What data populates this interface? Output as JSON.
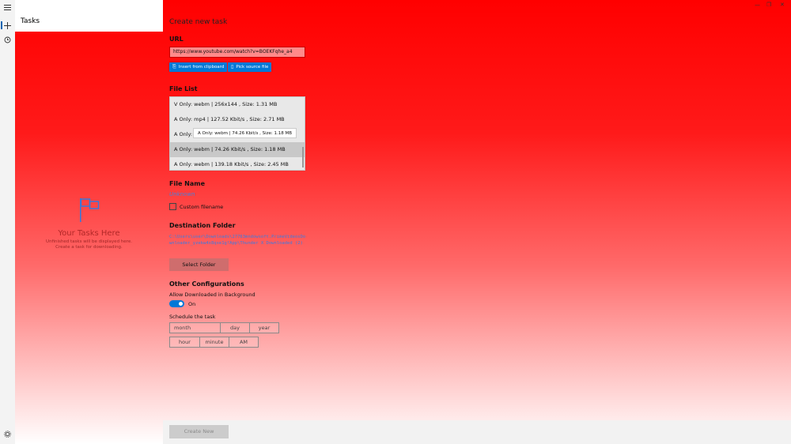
{
  "window": {
    "controls": [
      "—",
      "❐",
      "✕"
    ]
  },
  "nav": {
    "menu_icon": "hamburger-icon",
    "new_icon": "plus-icon",
    "history_icon": "history-icon",
    "settings_icon": "gear-icon"
  },
  "left_panel": {
    "title": "Tasks",
    "empty_title": "Your Tasks Here",
    "empty_line1": "Unfinished tasks will be displayed here.",
    "empty_line2": "Create a task for downloading."
  },
  "main": {
    "title": "Create new task",
    "url_section": "URL",
    "url_value": "https://www.youtube.com/watch?v=BOEKFqhe_a4",
    "insert_clipboard": "Insert from clipboard",
    "pick_source": "Pick source file",
    "file_list_section": "File List",
    "files": [
      "V Only: webm | 256x144 , Size: 1.31 MB",
      "A Only: mp4 | 127.52 Kbit/s , Size: 2.71 MB",
      "A Only: v",
      "A Only: webm | 74.26 Kbit/s , Size: 1.18 MB",
      "A Only: webm | 139.18 Kbit/s , Size: 2.45 MB"
    ],
    "tooltip": "A Only: webm | 74.26 Kbit/s , Size: 1.18 MB",
    "file_name_section": "File Name",
    "file_name_value": "Unknown",
    "custom_filename": "Custom filename",
    "destination_section": "Destination Folder",
    "destination_path": "C:\\Users\\user\\Downloads\\27763mndowsoft.PrimeVideosDownloader_yzekw4x8qxe1g!App\\Thunder X Downloaded (2)",
    "select_folder": "Select Folder",
    "other_section": "Other Configurations",
    "bg_label": "Allow Downloaded in Background",
    "toggle_state": "On",
    "schedule_label": "Schedule the task",
    "date": {
      "month": "month",
      "day": "day",
      "year": "year"
    },
    "time": {
      "hour": "hour",
      "minute": "minute",
      "ampm": "AM"
    },
    "create_button": "Create New"
  },
  "colors": {
    "accent": "#0078d7",
    "path": "#3c7be0"
  }
}
